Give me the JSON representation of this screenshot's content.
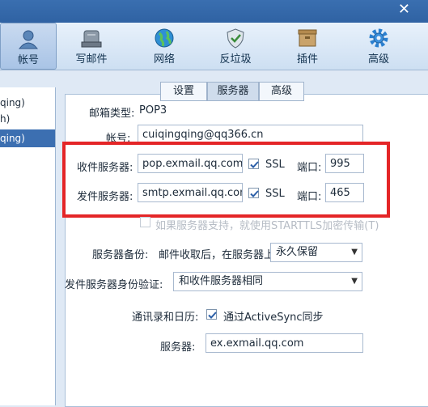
{
  "window": {
    "close_glyph": "✕"
  },
  "toolbar": {
    "items": [
      {
        "label": "帐号",
        "icon": "user-icon"
      },
      {
        "label": "写邮件",
        "icon": "compose-icon"
      },
      {
        "label": "网络",
        "icon": "globe-icon"
      },
      {
        "label": "反垃圾",
        "icon": "shield-icon"
      },
      {
        "label": "插件",
        "icon": "plugin-icon"
      },
      {
        "label": "高级",
        "icon": "gear-icon"
      }
    ]
  },
  "accounts": {
    "items": [
      "qing)",
      "h)",
      "qing)"
    ],
    "selected_index": 2
  },
  "tabs": {
    "items": [
      "设置",
      "服务器",
      "高级"
    ],
    "active_index": 1
  },
  "form": {
    "mailbox_type_label": "邮箱类型:",
    "mailbox_type_value": "POP3",
    "account_label": "帐号:",
    "account_value": "cuiqingqing@qq366.cn",
    "incoming_label": "收件服务器:",
    "incoming_value": "pop.exmail.qq.com",
    "incoming_ssl_label": "SSL",
    "incoming_port_label": "端口:",
    "incoming_port_value": "995",
    "outgoing_label": "发件服务器:",
    "outgoing_value": "smtp.exmail.qq.com",
    "outgoing_ssl_label": "SSL",
    "outgoing_port_label": "端口:",
    "outgoing_port_value": "465",
    "starttls_text": "如果服务器支持，就使用STARTTLS加密传输(T)",
    "backup_label": "服务器备份:",
    "backup_desc": "邮件收取后，在服务器上",
    "backup_value": "永久保留",
    "auth_label": "发件服务器身份验证:",
    "auth_value": "和收件服务器相同",
    "contacts_label": "通讯录和日历:",
    "activesync_label": "通过ActiveSync同步",
    "server_label": "服务器:",
    "server_value": "ex.exmail.qq.com"
  }
}
